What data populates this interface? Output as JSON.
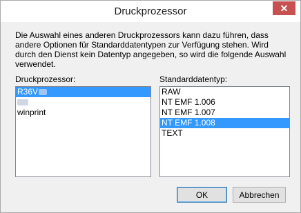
{
  "window": {
    "title": "Druckprozessor",
    "close_glyph": "✕"
  },
  "description": "Die Auswahl eines anderen Druckprozessors kann dazu führen, dass andere Optionen für Standarddatentypen zur Verfügung stehen. Wird durch den Dienst kein Datentyp angegeben, so wird die folgende Auswahl verwendet.",
  "processor_list": {
    "label": "Druckprozessor:",
    "items": [
      "R36V",
      "",
      "winprint"
    ],
    "selected_index": 0
  },
  "datatype_list": {
    "label": "Standarddatentyp:",
    "items": [
      "RAW",
      "NT EMF 1.006",
      "NT EMF 1.007",
      "NT EMF 1.008",
      "TEXT"
    ],
    "selected_index": 3
  },
  "buttons": {
    "ok": "OK",
    "cancel": "Abbrechen"
  },
  "colors": {
    "selection": "#3399ff",
    "close_button": "#c75050"
  }
}
